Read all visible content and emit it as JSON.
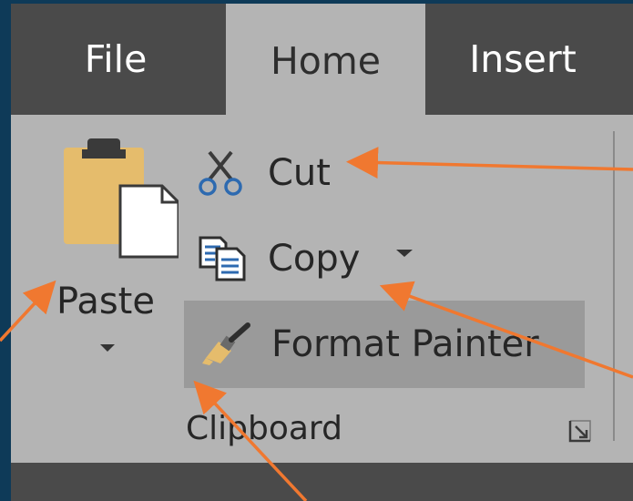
{
  "tabs": {
    "file": "File",
    "home": "Home",
    "insert": "Insert"
  },
  "clipboard": {
    "paste_label": "Paste",
    "cut_label": "Cut",
    "copy_label": "Copy",
    "format_painter_label": "Format Painter",
    "group_label": "Clipboard"
  },
  "colors": {
    "background": "#0e3a58",
    "tab_bar": "#4a4a4a",
    "ribbon": "#b4b4b4",
    "hover": "#9a9a9a",
    "arrow": "#f07830"
  },
  "icons": {
    "paste": "clipboard-icon",
    "cut": "scissors-icon",
    "copy": "copy-icon",
    "format_painter": "paintbrush-icon",
    "launcher": "dialog-launcher-icon"
  }
}
